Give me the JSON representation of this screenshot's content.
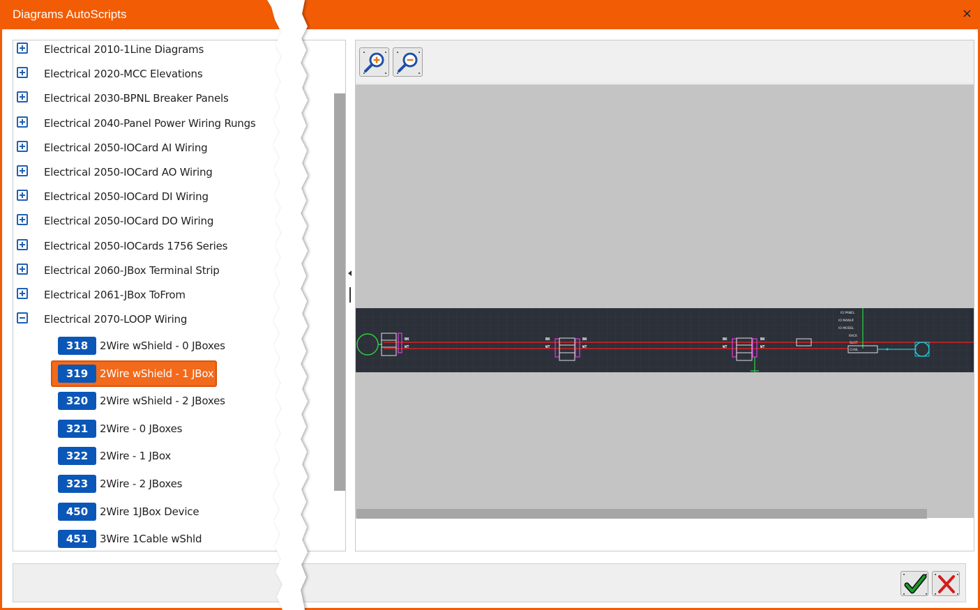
{
  "window": {
    "title": "Diagrams AutoScripts",
    "close_glyph": "×"
  },
  "tree": {
    "groups": [
      {
        "label": "Electrical 2010-1Line Diagrams",
        "expanded": false
      },
      {
        "label": "Electrical 2020-MCC Elevations",
        "expanded": false
      },
      {
        "label": "Electrical 2030-BPNL Breaker Panels",
        "expanded": false
      },
      {
        "label": "Electrical 2040-Panel Power Wiring Rungs",
        "expanded": false
      },
      {
        "label": "Electrical 2050-IOCard AI Wiring",
        "expanded": false
      },
      {
        "label": "Electrical 2050-IOCard AO Wiring",
        "expanded": false
      },
      {
        "label": "Electrical 2050-IOCard DI Wiring",
        "expanded": false
      },
      {
        "label": "Electrical 2050-IOCard DO Wiring",
        "expanded": false
      },
      {
        "label": "Electrical 2050-IOCards 1756 Series",
        "expanded": false
      },
      {
        "label": "Electrical 2060-JBox Terminal Strip",
        "expanded": false
      },
      {
        "label": "Electrical 2061-JBox ToFrom",
        "expanded": false
      },
      {
        "label": "Electrical 2070-LOOP Wiring",
        "expanded": true
      }
    ],
    "leaves": [
      {
        "id": "318",
        "label": "2Wire wShield - 0 JBoxes",
        "selected": false
      },
      {
        "id": "319",
        "label": "2Wire wShield - 1 JBox",
        "selected": true
      },
      {
        "id": "320",
        "label": "2Wire wShield - 2 JBoxes",
        "selected": false
      },
      {
        "id": "321",
        "label": "2Wire - 0 JBoxes",
        "selected": false
      },
      {
        "id": "322",
        "label": "2Wire - 1 JBox",
        "selected": false
      },
      {
        "id": "323",
        "label": "2Wire - 2 JBoxes",
        "selected": false
      },
      {
        "id": "450",
        "label": "2Wire 1JBox Device",
        "selected": false
      },
      {
        "id": "451",
        "label": "3Wire 1Cable wShld",
        "selected": false
      }
    ]
  },
  "preview": {
    "toolbar": {
      "zoom_in_icon": "zoom-in-icon",
      "zoom_out_icon": "zoom-out-icon"
    },
    "drawing": {
      "labels_left": [
        "BK",
        "WT"
      ],
      "labels_mid1_left": [
        "BK",
        "WT"
      ],
      "labels_mid1_right": [
        "BK",
        "WT"
      ],
      "labels_mid2_left": [
        "BK",
        "WT"
      ],
      "labels_mid2_right": [
        "BK",
        "WT"
      ],
      "io_stack": [
        "IO PANEL",
        "IO MANUF",
        "IO MODEL",
        "RACK",
        "SLOT",
        "CHNL"
      ]
    }
  },
  "footer": {
    "ok_icon": "checkmark-icon",
    "cancel_icon": "cancel-x-icon"
  },
  "colors": {
    "accent": "#f25c05",
    "badge": "#0b57b8",
    "selected": "#f26a1b",
    "wire_red": "#d42020",
    "wire_green": "#2ecc40",
    "magenta": "#d63ad6",
    "cyan": "#20c8d8"
  }
}
